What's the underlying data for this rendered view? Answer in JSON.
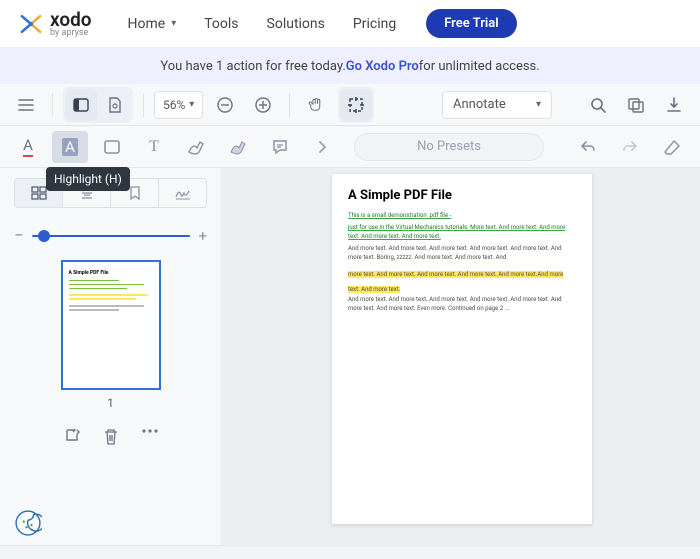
{
  "brand": {
    "name": "xodo",
    "tagline": "by apryse"
  },
  "nav": {
    "home": "Home",
    "tools": "Tools",
    "solutions": "Solutions",
    "pricing": "Pricing",
    "free_trial": "Free Trial"
  },
  "banner": {
    "pre": "You have 1 action for free today. ",
    "link": "Go Xodo Pro",
    "post": " for unlimited access."
  },
  "toolbar": {
    "zoom_value": "56%",
    "annotate_label": "Annotate"
  },
  "tools": {
    "tooltip_highlight": "Highlight (H)",
    "no_presets": "No Presets"
  },
  "sidebar": {
    "page_number": "1",
    "slider_minus": "−",
    "slider_plus": "+"
  },
  "doc": {
    "title": "A Simple PDF File",
    "lines": [
      {
        "t": "This is a small demonstration .pdf file -",
        "cls": "grn"
      },
      {
        "t": "just for use in the Virtual Mechanics tutorials. More text. And more text. And more text. And more text. And more text.",
        "cls": "grn"
      },
      {
        "t": "And more text. And more text. And more text. And more text. And more text. And more text. Boring, zzzzz. And more text. And more text. And",
        "cls": ""
      },
      {
        "t": "more text. And more text. And more text. And more text. And more text.",
        "cls": "yel"
      },
      {
        "t": "And more text. And more text.",
        "cls": "yel"
      },
      {
        "t": "And more text. And more text. And more text. And more text. And more text. And more text. And more text. Even more. Continued on page 2 ...",
        "cls": ""
      }
    ]
  }
}
